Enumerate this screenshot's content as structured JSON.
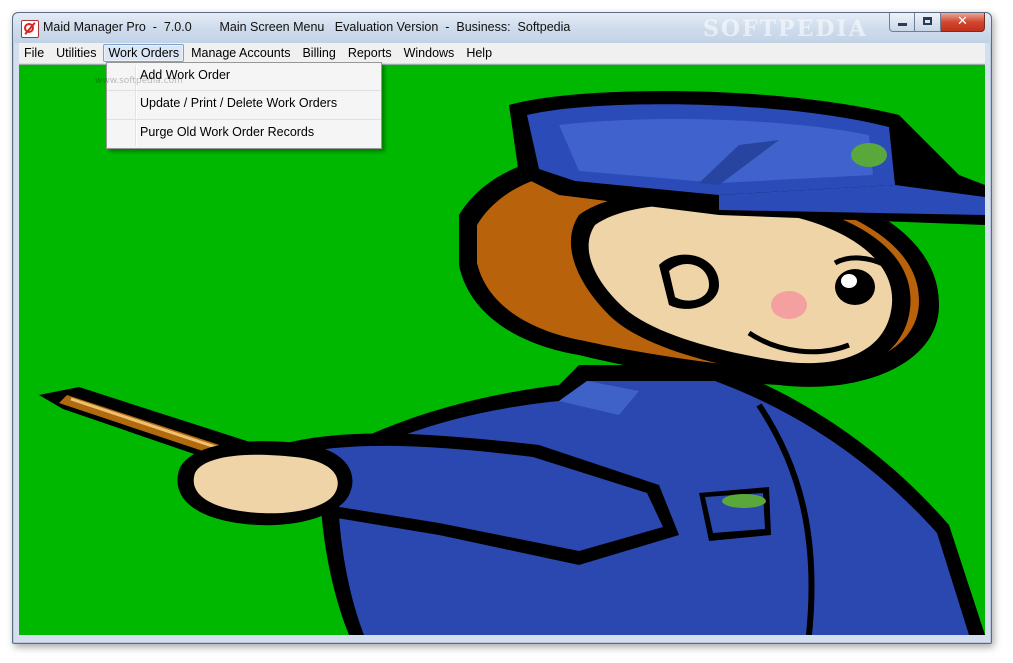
{
  "window": {
    "title": "Maid Manager Pro  -  7.0.0        Main Screen Menu   Evaluation Version  -  Business:  Softpedia",
    "watermark": "SOFTPEDIA"
  },
  "menubar": {
    "items": [
      "File",
      "Utilities",
      "Work Orders",
      "Manage Accounts",
      "Billing",
      "Reports",
      "Windows",
      "Help"
    ],
    "active": "Work Orders"
  },
  "dropdown": {
    "items": [
      "Add Work Order",
      "Update / Print / Delete Work Orders",
      "Purge Old Work Order Records"
    ]
  },
  "overlay_watermark": "www.softpedia.com",
  "colors": {
    "background": "#00b800",
    "uniform": "#2b48b0",
    "hat": "#2a4bb8",
    "skin": "#efd4a8",
    "hair": "#b8620c",
    "broom": "#b06a10"
  }
}
